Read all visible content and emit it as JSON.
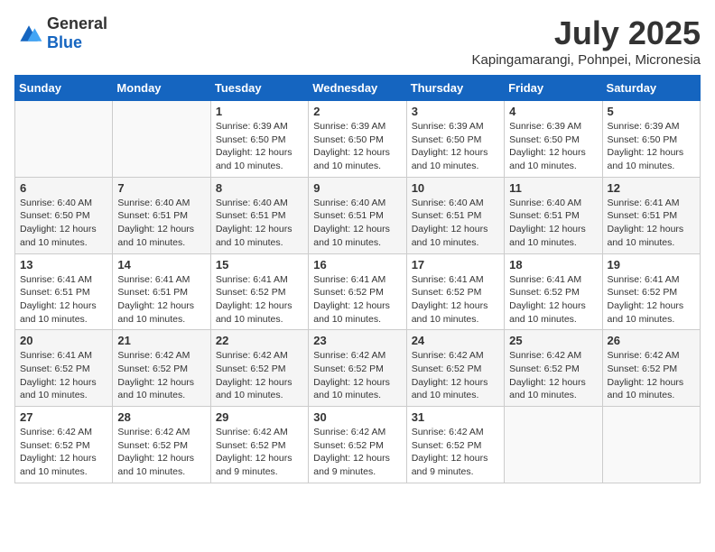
{
  "logo": {
    "general": "General",
    "blue": "Blue"
  },
  "header": {
    "month_year": "July 2025",
    "location": "Kapingamarangi, Pohnpei, Micronesia"
  },
  "weekdays": [
    "Sunday",
    "Monday",
    "Tuesday",
    "Wednesday",
    "Thursday",
    "Friday",
    "Saturday"
  ],
  "weeks": [
    [
      {
        "day": "",
        "info": ""
      },
      {
        "day": "",
        "info": ""
      },
      {
        "day": "1",
        "info": "Sunrise: 6:39 AM\nSunset: 6:50 PM\nDaylight: 12 hours and 10 minutes."
      },
      {
        "day": "2",
        "info": "Sunrise: 6:39 AM\nSunset: 6:50 PM\nDaylight: 12 hours and 10 minutes."
      },
      {
        "day": "3",
        "info": "Sunrise: 6:39 AM\nSunset: 6:50 PM\nDaylight: 12 hours and 10 minutes."
      },
      {
        "day": "4",
        "info": "Sunrise: 6:39 AM\nSunset: 6:50 PM\nDaylight: 12 hours and 10 minutes."
      },
      {
        "day": "5",
        "info": "Sunrise: 6:39 AM\nSunset: 6:50 PM\nDaylight: 12 hours and 10 minutes."
      }
    ],
    [
      {
        "day": "6",
        "info": "Sunrise: 6:40 AM\nSunset: 6:50 PM\nDaylight: 12 hours and 10 minutes."
      },
      {
        "day": "7",
        "info": "Sunrise: 6:40 AM\nSunset: 6:51 PM\nDaylight: 12 hours and 10 minutes."
      },
      {
        "day": "8",
        "info": "Sunrise: 6:40 AM\nSunset: 6:51 PM\nDaylight: 12 hours and 10 minutes."
      },
      {
        "day": "9",
        "info": "Sunrise: 6:40 AM\nSunset: 6:51 PM\nDaylight: 12 hours and 10 minutes."
      },
      {
        "day": "10",
        "info": "Sunrise: 6:40 AM\nSunset: 6:51 PM\nDaylight: 12 hours and 10 minutes."
      },
      {
        "day": "11",
        "info": "Sunrise: 6:40 AM\nSunset: 6:51 PM\nDaylight: 12 hours and 10 minutes."
      },
      {
        "day": "12",
        "info": "Sunrise: 6:41 AM\nSunset: 6:51 PM\nDaylight: 12 hours and 10 minutes."
      }
    ],
    [
      {
        "day": "13",
        "info": "Sunrise: 6:41 AM\nSunset: 6:51 PM\nDaylight: 12 hours and 10 minutes."
      },
      {
        "day": "14",
        "info": "Sunrise: 6:41 AM\nSunset: 6:51 PM\nDaylight: 12 hours and 10 minutes."
      },
      {
        "day": "15",
        "info": "Sunrise: 6:41 AM\nSunset: 6:52 PM\nDaylight: 12 hours and 10 minutes."
      },
      {
        "day": "16",
        "info": "Sunrise: 6:41 AM\nSunset: 6:52 PM\nDaylight: 12 hours and 10 minutes."
      },
      {
        "day": "17",
        "info": "Sunrise: 6:41 AM\nSunset: 6:52 PM\nDaylight: 12 hours and 10 minutes."
      },
      {
        "day": "18",
        "info": "Sunrise: 6:41 AM\nSunset: 6:52 PM\nDaylight: 12 hours and 10 minutes."
      },
      {
        "day": "19",
        "info": "Sunrise: 6:41 AM\nSunset: 6:52 PM\nDaylight: 12 hours and 10 minutes."
      }
    ],
    [
      {
        "day": "20",
        "info": "Sunrise: 6:41 AM\nSunset: 6:52 PM\nDaylight: 12 hours and 10 minutes."
      },
      {
        "day": "21",
        "info": "Sunrise: 6:42 AM\nSunset: 6:52 PM\nDaylight: 12 hours and 10 minutes."
      },
      {
        "day": "22",
        "info": "Sunrise: 6:42 AM\nSunset: 6:52 PM\nDaylight: 12 hours and 10 minutes."
      },
      {
        "day": "23",
        "info": "Sunrise: 6:42 AM\nSunset: 6:52 PM\nDaylight: 12 hours and 10 minutes."
      },
      {
        "day": "24",
        "info": "Sunrise: 6:42 AM\nSunset: 6:52 PM\nDaylight: 12 hours and 10 minutes."
      },
      {
        "day": "25",
        "info": "Sunrise: 6:42 AM\nSunset: 6:52 PM\nDaylight: 12 hours and 10 minutes."
      },
      {
        "day": "26",
        "info": "Sunrise: 6:42 AM\nSunset: 6:52 PM\nDaylight: 12 hours and 10 minutes."
      }
    ],
    [
      {
        "day": "27",
        "info": "Sunrise: 6:42 AM\nSunset: 6:52 PM\nDaylight: 12 hours and 10 minutes."
      },
      {
        "day": "28",
        "info": "Sunrise: 6:42 AM\nSunset: 6:52 PM\nDaylight: 12 hours and 10 minutes."
      },
      {
        "day": "29",
        "info": "Sunrise: 6:42 AM\nSunset: 6:52 PM\nDaylight: 12 hours and 9 minutes."
      },
      {
        "day": "30",
        "info": "Sunrise: 6:42 AM\nSunset: 6:52 PM\nDaylight: 12 hours and 9 minutes."
      },
      {
        "day": "31",
        "info": "Sunrise: 6:42 AM\nSunset: 6:52 PM\nDaylight: 12 hours and 9 minutes."
      },
      {
        "day": "",
        "info": ""
      },
      {
        "day": "",
        "info": ""
      }
    ]
  ]
}
